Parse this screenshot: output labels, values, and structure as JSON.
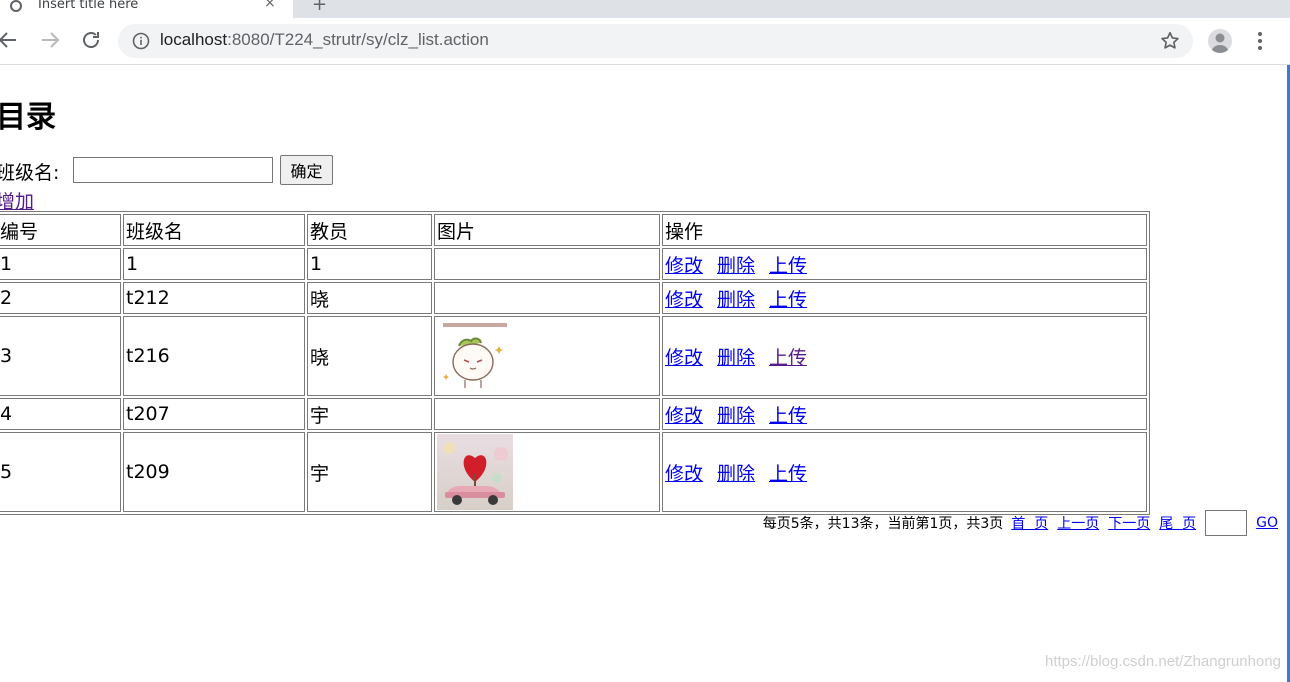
{
  "browser": {
    "tab_title": "Insert title here",
    "tab_close": "×",
    "new_tab": "+",
    "url_host": "localhost",
    "url_rest": ":8080/T224_strutr/sy/clz_list.action"
  },
  "page": {
    "title": "目录",
    "search_label": "班级名:",
    "search_value": "",
    "confirm_label": "确定",
    "add_label": "增加"
  },
  "table": {
    "headers": [
      "编号",
      "班级名",
      "教员",
      "图片",
      "操作"
    ],
    "rows": [
      {
        "id": "1",
        "name": "1",
        "teacher": "1",
        "image": "none"
      },
      {
        "id": "2",
        "name": "t212",
        "teacher": "晓",
        "image": "none"
      },
      {
        "id": "3",
        "name": "t216",
        "teacher": "晓",
        "image": "cartoon-sticker"
      },
      {
        "id": "4",
        "name": "t207",
        "teacher": "宇",
        "image": "none"
      },
      {
        "id": "5",
        "name": "t209",
        "teacher": "宇",
        "image": "pink-car-heart"
      }
    ],
    "actions": {
      "edit": "修改",
      "delete": "删除",
      "upload": "上传"
    }
  },
  "pager": {
    "info": "每页5条，共13条，当前第1页，共3页",
    "first": "首  页",
    "prev": "上一页",
    "next": "下一页",
    "last": "尾  页",
    "go_value": "",
    "go": "GO"
  },
  "watermark": "https://blog.csdn.net/Zhangrunhong",
  "colors": {
    "link": "#0000ee",
    "visited": "#551a8b",
    "accent_line": "#3c78d8"
  }
}
